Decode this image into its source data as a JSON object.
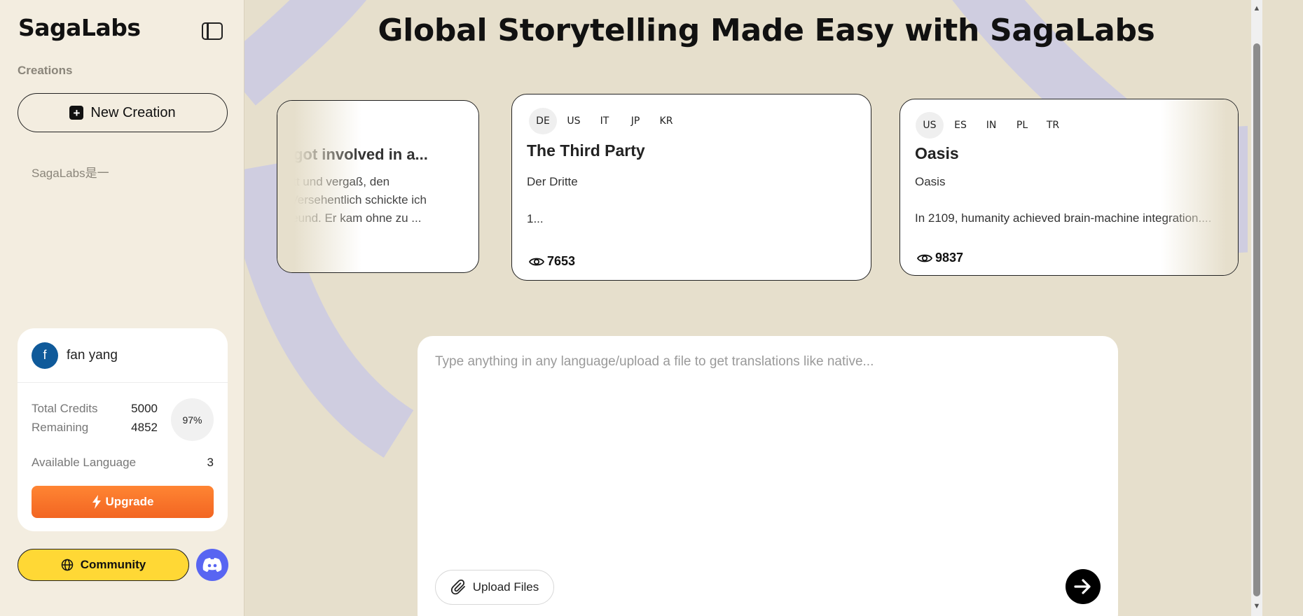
{
  "sidebar": {
    "logo": "SagaLabs",
    "section_label": "Creations",
    "new_creation_label": "New Creation",
    "history": [
      "SagaLabs是一"
    ],
    "user": {
      "initial": "f",
      "name": "fan yang",
      "total_credits_label": "Total Credits",
      "total_credits": "5000",
      "remaining_label": "Remaining",
      "remaining": "4852",
      "percent": "97%",
      "available_language_label": "Available Language",
      "available_language": "3",
      "upgrade_label": "Upgrade"
    },
    "community_label": "Community"
  },
  "main": {
    "title": "Global Storytelling Made Easy with SagaLabs",
    "cards": [
      {
        "title": "nd got involved in a...",
        "body": [
          "elbett und vergaß, den",
          "en. Versehentlich schickte ich",
          "x-Freund. Er kam ohne zu ..."
        ]
      },
      {
        "langs": [
          "DE",
          "US",
          "IT",
          "JP",
          "KR"
        ],
        "title": "The Third Party",
        "subtitle": "Der Dritte",
        "body": "1...",
        "views": "7653"
      },
      {
        "langs": [
          "US",
          "ES",
          "IN",
          "PL",
          "TR"
        ],
        "title": "Oasis",
        "subtitle": "Oasis",
        "body": "In 2109, humanity achieved brain-machine integration....",
        "views": "9837"
      }
    ],
    "input": {
      "placeholder": "Type anything in any language/upload a file to get translations like native...",
      "upload_label": "Upload Files"
    }
  },
  "colors": {
    "background": "#e6dfcc",
    "sidebar": "#f3ede0",
    "accent_orange": "#f26522",
    "community_yellow": "#ffd835",
    "discord": "#5865f2",
    "avatar": "#0f5a9a"
  },
  "icons": [
    "sidebar-toggle-icon",
    "plus-icon",
    "lightning-icon",
    "globe-icon",
    "discord-icon",
    "eye-icon",
    "paperclip-icon",
    "arrow-right-icon"
  ]
}
